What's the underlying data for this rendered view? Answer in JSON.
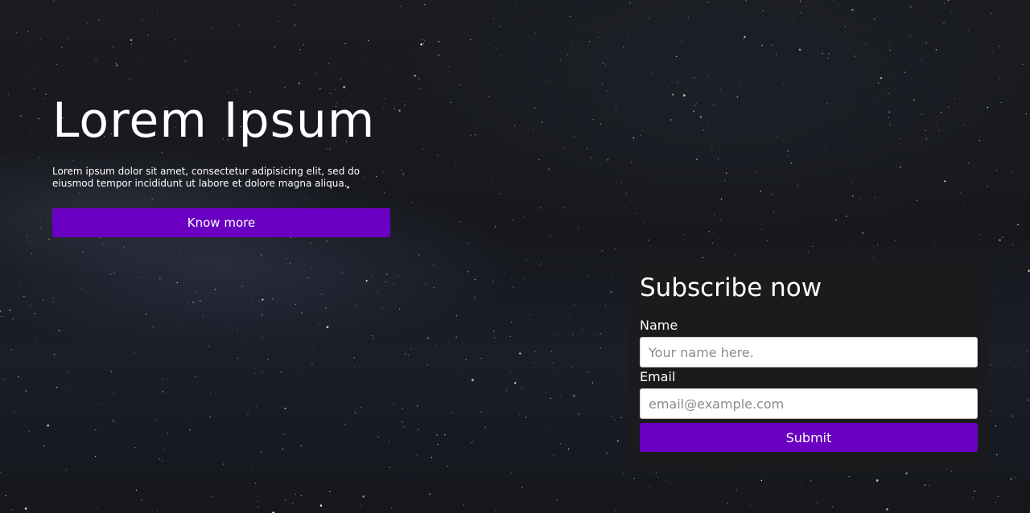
{
  "hero": {
    "title": "Lorem Ipsum",
    "text": "Lorem ipsum dolor sit amet, consectetur adipisicing elit, sed do eiusmod tempor incididunt ut labore et dolore magna aliqua.",
    "button_label": "Know more"
  },
  "subscribe": {
    "title": "Subscribe now",
    "name_label": "Name",
    "name_placeholder": "Your name here.",
    "name_value": "",
    "email_label": "Email",
    "email_placeholder": "email@example.com",
    "email_value": "",
    "submit_label": "Submit"
  },
  "colors": {
    "accent": "#6a00c1",
    "panel": "#1b1b1d",
    "background": "#15171c"
  }
}
